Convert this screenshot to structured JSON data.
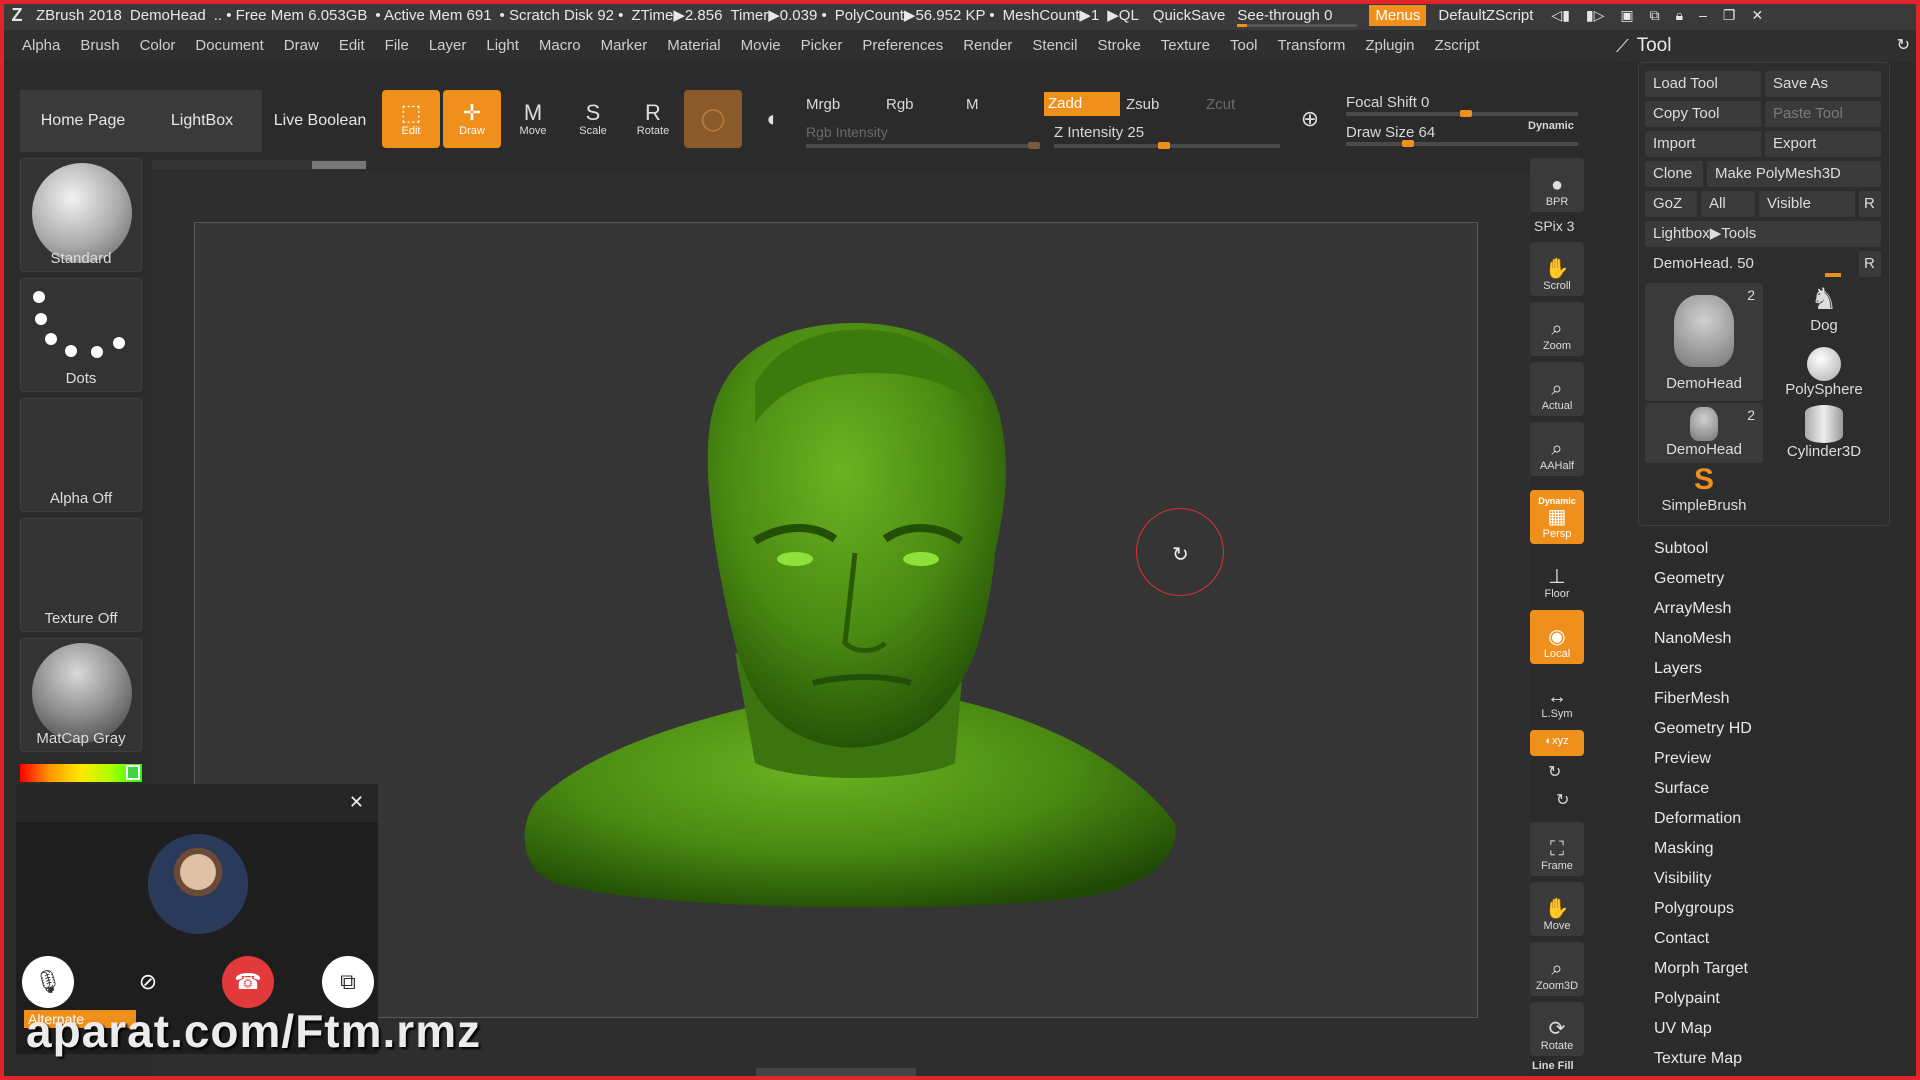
{
  "titlebar": {
    "app": "ZBrush 2018",
    "doc": "DemoHead",
    "free_mem": ".. • Free Mem 6.053GB",
    "active_mem": "• Active Mem 691",
    "scratch": "• Scratch Disk 92 •",
    "ztime": "ZTime▶2.856",
    "timer": "Timer▶0.039 •",
    "polycount": "PolyCount▶56.952 KP •",
    "meshcount": "MeshCount▶1",
    "ql": "▶QL",
    "quicksave": "QuickSave",
    "see_through": "See-through  0",
    "menus": "Menus",
    "script": "DefaultZScript"
  },
  "menubar": [
    "Alpha",
    "Brush",
    "Color",
    "Document",
    "Draw",
    "Edit",
    "File",
    "Layer",
    "Light",
    "Macro",
    "Marker",
    "Material",
    "Movie",
    "Picker",
    "Preferences",
    "Render",
    "Stencil",
    "Stroke",
    "Texture",
    "Tool",
    "Transform",
    "Zplugin",
    "Zscript"
  ],
  "toolpanel_title": "Tool",
  "shelf": {
    "home": "Home Page",
    "lightbox": "LightBox",
    "liveboolean": "Live Boolean",
    "edit": "Edit",
    "draw": "Draw",
    "move": "Move",
    "scale": "Scale",
    "rotate": "Rotate",
    "mrgb": "Mrgb",
    "rgb": "Rgb",
    "m": "M",
    "zadd": "Zadd",
    "zsub": "Zsub",
    "zcut": "Zcut",
    "rgb_intensity": "Rgb Intensity",
    "z_intensity": "Z Intensity 25",
    "focal_shift": "Focal Shift 0",
    "draw_size": "Draw Size 64",
    "dynamic": "Dynamic"
  },
  "left": {
    "brush": "Standard",
    "stroke": "Dots",
    "alpha": "Alpha Off",
    "texture": "Texture Off",
    "material": "MatCap Gray"
  },
  "right_bar": {
    "bpr": "BPR",
    "spix": "SPix 3",
    "scroll": "Scroll",
    "zoom": "Zoom",
    "actual": "Actual",
    "aahalf": "AAHalf",
    "persp_dyn": "Dynamic",
    "persp": "Persp",
    "floor": "Floor",
    "local": "Local",
    "lsym": "L.Sym",
    "xyz": "◐xyz",
    "frame": "Frame",
    "move": "Move",
    "zoom3d": "Zoom3D",
    "rotate": "Rotate",
    "linefill": "Line Fill"
  },
  "tool_panel": {
    "load": "Load Tool",
    "saveas": "Save As",
    "copy": "Copy Tool",
    "paste": "Paste Tool",
    "import": "Import",
    "export": "Export",
    "clone": "Clone",
    "polymesh": "Make PolyMesh3D",
    "goz": "GoZ",
    "all": "All",
    "visible": "Visible",
    "r": "R",
    "lightbox_tools": "Lightbox▶Tools",
    "current": "DemoHead. 50",
    "thumbs": [
      {
        "name": "DemoHead",
        "count": "2"
      },
      {
        "name": "Dog",
        "count": ""
      },
      {
        "name": "PolySphere",
        "count": ""
      },
      {
        "name": "DemoHead",
        "count": "2"
      },
      {
        "name": "Cylinder3D",
        "count": ""
      },
      {
        "name": "SimpleBrush",
        "count": ""
      }
    ]
  },
  "sections": [
    "Subtool",
    "Geometry",
    "ArrayMesh",
    "NanoMesh",
    "Layers",
    "FiberMesh",
    "Geometry HD",
    "Preview",
    "Surface",
    "Deformation",
    "Masking",
    "Visibility",
    "Polygroups",
    "Contact",
    "Morph Target",
    "Polypaint",
    "UV Map",
    "Texture Map"
  ],
  "call": {
    "alternate": "Alternate"
  },
  "watermark": "aparat.com/Ftm.rmz",
  "colors": {
    "accent": "#f0901c",
    "model": "#4f8f16",
    "frame": "#e0242c"
  }
}
